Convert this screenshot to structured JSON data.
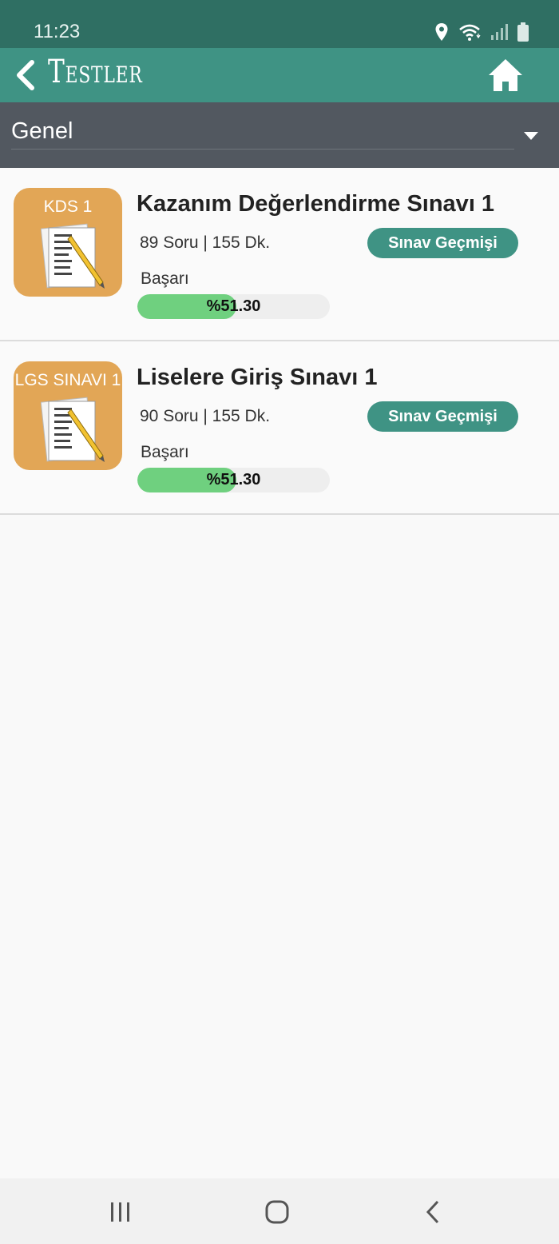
{
  "status_bar": {
    "time": "11:23",
    "icons": [
      "location-icon",
      "wifi-icon",
      "signal-icon",
      "battery-icon"
    ]
  },
  "header": {
    "title": "Testler",
    "back_icon": "chevron-left-icon",
    "home_icon": "home-icon"
  },
  "filter": {
    "selected": "Genel",
    "dropdown_icon": "caret-down-icon"
  },
  "tests": [
    {
      "thumb_label": "KDS 1",
      "title": "Kazanım Değerlendirme Sınavı 1",
      "meta": "89 Soru | 155 Dk.",
      "history_label": "Sınav Geçmişi",
      "success_label": "Başarı",
      "success_text": "%51.30",
      "success_value": 51.3
    },
    {
      "thumb_label": "LGS SINAVI 1",
      "title": "Liselere Giriş Sınavı 1",
      "meta": "90 Soru | 155 Dk.",
      "history_label": "Sınav Geçmişi",
      "success_label": "Başarı",
      "success_text": "%51.30",
      "success_value": 51.3
    }
  ],
  "nav_bar": {
    "buttons": [
      "recent-apps-icon",
      "home-circle-icon",
      "back-icon"
    ]
  },
  "colors": {
    "status_bar": "#2f6f63",
    "app_bar": "#3f9384",
    "filter_bar": "#525860",
    "thumb_bg": "#e2a656",
    "progress_fill": "#6fd07f",
    "progress_track": "#eeeeee"
  }
}
